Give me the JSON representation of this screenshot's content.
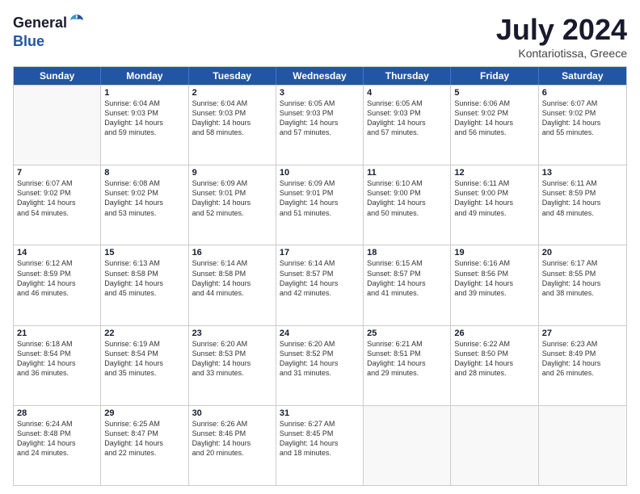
{
  "logo": {
    "general": "General",
    "blue": "Blue"
  },
  "title": {
    "month_year": "July 2024",
    "location": "Kontariotissa, Greece"
  },
  "header_days": [
    "Sunday",
    "Monday",
    "Tuesday",
    "Wednesday",
    "Thursday",
    "Friday",
    "Saturday"
  ],
  "weeks": [
    [
      {
        "day": "",
        "empty": true
      },
      {
        "day": "1",
        "sunrise": "Sunrise: 6:04 AM",
        "sunset": "Sunset: 9:03 PM",
        "daylight": "Daylight: 14 hours",
        "daylight2": "and 59 minutes."
      },
      {
        "day": "2",
        "sunrise": "Sunrise: 6:04 AM",
        "sunset": "Sunset: 9:03 PM",
        "daylight": "Daylight: 14 hours",
        "daylight2": "and 58 minutes."
      },
      {
        "day": "3",
        "sunrise": "Sunrise: 6:05 AM",
        "sunset": "Sunset: 9:03 PM",
        "daylight": "Daylight: 14 hours",
        "daylight2": "and 57 minutes."
      },
      {
        "day": "4",
        "sunrise": "Sunrise: 6:05 AM",
        "sunset": "Sunset: 9:03 PM",
        "daylight": "Daylight: 14 hours",
        "daylight2": "and 57 minutes."
      },
      {
        "day": "5",
        "sunrise": "Sunrise: 6:06 AM",
        "sunset": "Sunset: 9:02 PM",
        "daylight": "Daylight: 14 hours",
        "daylight2": "and 56 minutes."
      },
      {
        "day": "6",
        "sunrise": "Sunrise: 6:07 AM",
        "sunset": "Sunset: 9:02 PM",
        "daylight": "Daylight: 14 hours",
        "daylight2": "and 55 minutes."
      }
    ],
    [
      {
        "day": "7",
        "sunrise": "Sunrise: 6:07 AM",
        "sunset": "Sunset: 9:02 PM",
        "daylight": "Daylight: 14 hours",
        "daylight2": "and 54 minutes."
      },
      {
        "day": "8",
        "sunrise": "Sunrise: 6:08 AM",
        "sunset": "Sunset: 9:02 PM",
        "daylight": "Daylight: 14 hours",
        "daylight2": "and 53 minutes."
      },
      {
        "day": "9",
        "sunrise": "Sunrise: 6:09 AM",
        "sunset": "Sunset: 9:01 PM",
        "daylight": "Daylight: 14 hours",
        "daylight2": "and 52 minutes."
      },
      {
        "day": "10",
        "sunrise": "Sunrise: 6:09 AM",
        "sunset": "Sunset: 9:01 PM",
        "daylight": "Daylight: 14 hours",
        "daylight2": "and 51 minutes."
      },
      {
        "day": "11",
        "sunrise": "Sunrise: 6:10 AM",
        "sunset": "Sunset: 9:00 PM",
        "daylight": "Daylight: 14 hours",
        "daylight2": "and 50 minutes."
      },
      {
        "day": "12",
        "sunrise": "Sunrise: 6:11 AM",
        "sunset": "Sunset: 9:00 PM",
        "daylight": "Daylight: 14 hours",
        "daylight2": "and 49 minutes."
      },
      {
        "day": "13",
        "sunrise": "Sunrise: 6:11 AM",
        "sunset": "Sunset: 8:59 PM",
        "daylight": "Daylight: 14 hours",
        "daylight2": "and 48 minutes."
      }
    ],
    [
      {
        "day": "14",
        "sunrise": "Sunrise: 6:12 AM",
        "sunset": "Sunset: 8:59 PM",
        "daylight": "Daylight: 14 hours",
        "daylight2": "and 46 minutes."
      },
      {
        "day": "15",
        "sunrise": "Sunrise: 6:13 AM",
        "sunset": "Sunset: 8:58 PM",
        "daylight": "Daylight: 14 hours",
        "daylight2": "and 45 minutes."
      },
      {
        "day": "16",
        "sunrise": "Sunrise: 6:14 AM",
        "sunset": "Sunset: 8:58 PM",
        "daylight": "Daylight: 14 hours",
        "daylight2": "and 44 minutes."
      },
      {
        "day": "17",
        "sunrise": "Sunrise: 6:14 AM",
        "sunset": "Sunset: 8:57 PM",
        "daylight": "Daylight: 14 hours",
        "daylight2": "and 42 minutes."
      },
      {
        "day": "18",
        "sunrise": "Sunrise: 6:15 AM",
        "sunset": "Sunset: 8:57 PM",
        "daylight": "Daylight: 14 hours",
        "daylight2": "and 41 minutes."
      },
      {
        "day": "19",
        "sunrise": "Sunrise: 6:16 AM",
        "sunset": "Sunset: 8:56 PM",
        "daylight": "Daylight: 14 hours",
        "daylight2": "and 39 minutes."
      },
      {
        "day": "20",
        "sunrise": "Sunrise: 6:17 AM",
        "sunset": "Sunset: 8:55 PM",
        "daylight": "Daylight: 14 hours",
        "daylight2": "and 38 minutes."
      }
    ],
    [
      {
        "day": "21",
        "sunrise": "Sunrise: 6:18 AM",
        "sunset": "Sunset: 8:54 PM",
        "daylight": "Daylight: 14 hours",
        "daylight2": "and 36 minutes."
      },
      {
        "day": "22",
        "sunrise": "Sunrise: 6:19 AM",
        "sunset": "Sunset: 8:54 PM",
        "daylight": "Daylight: 14 hours",
        "daylight2": "and 35 minutes."
      },
      {
        "day": "23",
        "sunrise": "Sunrise: 6:20 AM",
        "sunset": "Sunset: 8:53 PM",
        "daylight": "Daylight: 14 hours",
        "daylight2": "and 33 minutes."
      },
      {
        "day": "24",
        "sunrise": "Sunrise: 6:20 AM",
        "sunset": "Sunset: 8:52 PM",
        "daylight": "Daylight: 14 hours",
        "daylight2": "and 31 minutes."
      },
      {
        "day": "25",
        "sunrise": "Sunrise: 6:21 AM",
        "sunset": "Sunset: 8:51 PM",
        "daylight": "Daylight: 14 hours",
        "daylight2": "and 29 minutes."
      },
      {
        "day": "26",
        "sunrise": "Sunrise: 6:22 AM",
        "sunset": "Sunset: 8:50 PM",
        "daylight": "Daylight: 14 hours",
        "daylight2": "and 28 minutes."
      },
      {
        "day": "27",
        "sunrise": "Sunrise: 6:23 AM",
        "sunset": "Sunset: 8:49 PM",
        "daylight": "Daylight: 14 hours",
        "daylight2": "and 26 minutes."
      }
    ],
    [
      {
        "day": "28",
        "sunrise": "Sunrise: 6:24 AM",
        "sunset": "Sunset: 8:48 PM",
        "daylight": "Daylight: 14 hours",
        "daylight2": "and 24 minutes."
      },
      {
        "day": "29",
        "sunrise": "Sunrise: 6:25 AM",
        "sunset": "Sunset: 8:47 PM",
        "daylight": "Daylight: 14 hours",
        "daylight2": "and 22 minutes."
      },
      {
        "day": "30",
        "sunrise": "Sunrise: 6:26 AM",
        "sunset": "Sunset: 8:46 PM",
        "daylight": "Daylight: 14 hours",
        "daylight2": "and 20 minutes."
      },
      {
        "day": "31",
        "sunrise": "Sunrise: 6:27 AM",
        "sunset": "Sunset: 8:45 PM",
        "daylight": "Daylight: 14 hours",
        "daylight2": "and 18 minutes."
      },
      {
        "day": "",
        "empty": true
      },
      {
        "day": "",
        "empty": true
      },
      {
        "day": "",
        "empty": true
      }
    ]
  ]
}
